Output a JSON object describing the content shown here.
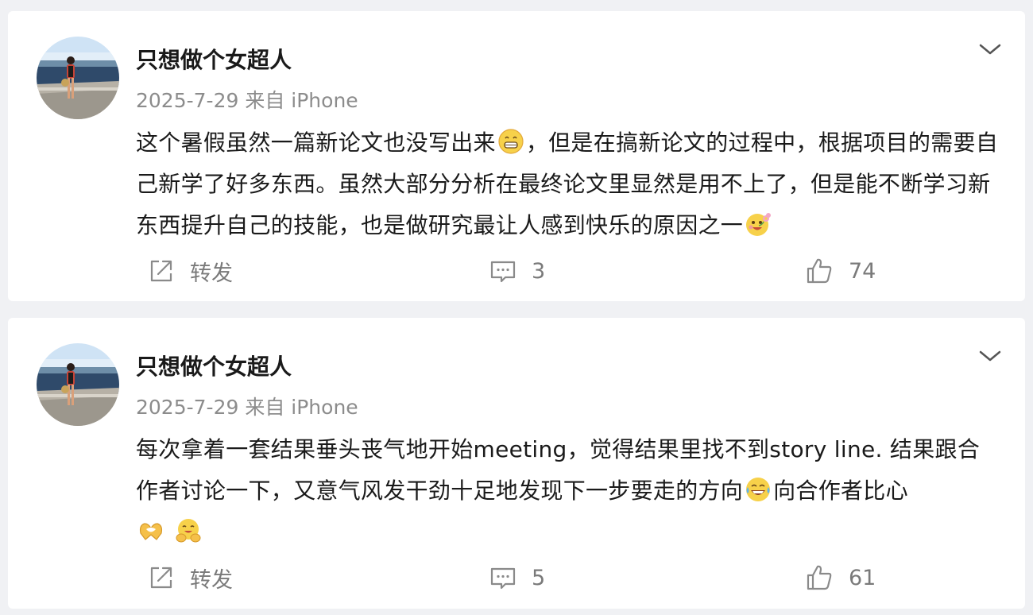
{
  "posts": [
    {
      "username": "只想做个女超人",
      "meta": "2025-7-29  来自 iPhone",
      "text_parts": [
        "这个暑假虽然一篇新论文也没写出来",
        "，但是在搞新论文的过程中，根据项目的需要自己新学了好多东西。虽然大部分分析在最终论文里显然是用不上了，但是能不断学习新东西提升自己的技能，也是做研究最让人感到快乐的原因之一",
        ""
      ],
      "emojis": [
        "grin-sweat-emoji",
        "happy-flower-emoji"
      ],
      "repost_label": "转发",
      "comment_count": "3",
      "like_count": "74"
    },
    {
      "username": "只想做个女超人",
      "meta": "2025-7-29  来自 iPhone",
      "text_parts": [
        "每次拿着一套结果垂头丧气地开始meeting，觉得结果里找不到story line. 结果跟合作者讨论一下，又意气风发干劲十足地发现下一步要走的方向",
        "向合作者比心",
        " "
      ],
      "emojis": [
        "tears-of-joy-emoji",
        "heart-hands-emoji",
        "hug-emoji"
      ],
      "repost_label": "转发",
      "comment_count": "5",
      "like_count": "61"
    }
  ],
  "colors": {
    "background": "#f0f1f4",
    "card": "#ffffff",
    "text": "#1a1a1a",
    "meta": "#8c8c8c",
    "action": "#7a7a7a"
  }
}
